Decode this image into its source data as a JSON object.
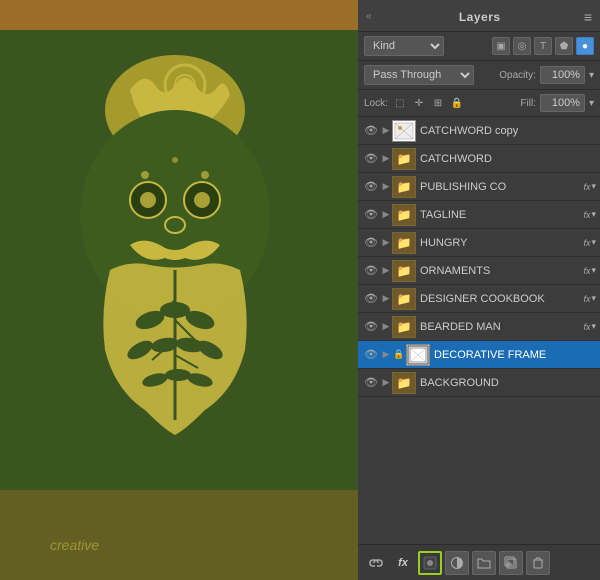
{
  "canvas": {
    "bg_color": "#3a5520"
  },
  "panel": {
    "title": "Layers",
    "menu_icon": "≡",
    "collapse_left": "«",
    "collapse_top": "«"
  },
  "kind_row": {
    "label": "Kind",
    "filter_icons": [
      "pixel-icon",
      "adjustment-icon",
      "type-icon",
      "shape-icon",
      "smartobject-icon"
    ]
  },
  "blend_row": {
    "blend_mode": "Pass Through",
    "opacity_label": "Opacity:",
    "opacity_value": "100%"
  },
  "lock_row": {
    "lock_label": "Lock:",
    "fill_label": "Fill:",
    "fill_value": "100%"
  },
  "layers": [
    {
      "name": "CATCHWORD copy",
      "visible": true,
      "has_thumb": true,
      "thumb_type": "image",
      "selected": false,
      "has_fx": false,
      "expanded": false,
      "type": "layer"
    },
    {
      "name": "CATCHWORD",
      "visible": true,
      "has_thumb": false,
      "thumb_type": "folder",
      "selected": false,
      "has_fx": false,
      "expanded": false,
      "type": "folder"
    },
    {
      "name": "PUBLISHING CO",
      "visible": true,
      "has_thumb": false,
      "thumb_type": "folder",
      "selected": false,
      "has_fx": true,
      "expanded": false,
      "type": "folder"
    },
    {
      "name": "TAGLINE",
      "visible": true,
      "has_thumb": false,
      "thumb_type": "folder",
      "selected": false,
      "has_fx": true,
      "expanded": false,
      "type": "folder"
    },
    {
      "name": "HUNGRY",
      "visible": true,
      "has_thumb": false,
      "thumb_type": "folder",
      "selected": false,
      "has_fx": true,
      "expanded": false,
      "type": "folder"
    },
    {
      "name": "ORNAMENTS",
      "visible": true,
      "has_thumb": false,
      "thumb_type": "folder",
      "selected": false,
      "has_fx": true,
      "expanded": false,
      "type": "folder"
    },
    {
      "name": "DESIGNER COOKBOOK",
      "visible": true,
      "has_thumb": false,
      "thumb_type": "folder",
      "selected": false,
      "has_fx": true,
      "expanded": false,
      "type": "folder"
    },
    {
      "name": "BEARDED MAN",
      "visible": true,
      "has_thumb": false,
      "thumb_type": "folder",
      "selected": false,
      "has_fx": true,
      "expanded": false,
      "type": "folder"
    },
    {
      "name": "DECORATIVE FRAME",
      "visible": true,
      "has_thumb": true,
      "thumb_type": "frame",
      "selected": true,
      "has_fx": false,
      "expanded": false,
      "has_lock": true,
      "type": "layer"
    },
    {
      "name": "BACKGROUND",
      "visible": true,
      "has_thumb": false,
      "thumb_type": "folder",
      "selected": false,
      "has_fx": false,
      "expanded": false,
      "type": "folder"
    }
  ],
  "toolbar": {
    "link_icon": "🔗",
    "fx_label": "fx",
    "layer_style_icon": "⬤",
    "adjustment_icon": "◑",
    "folder_icon": "📁",
    "new_layer_icon": "📄",
    "delete_icon": "🗑"
  }
}
